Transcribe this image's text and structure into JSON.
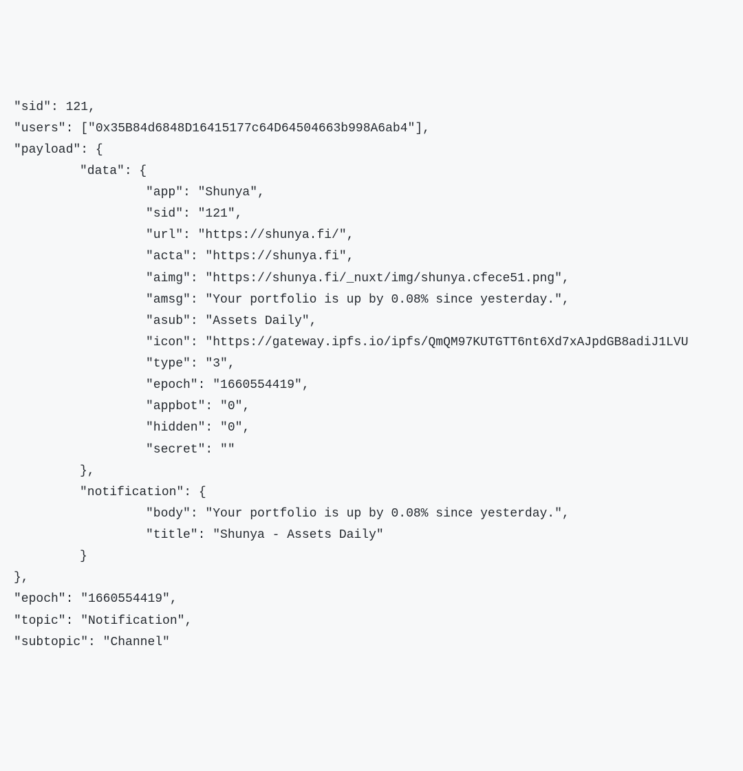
{
  "code": {
    "sid_key": "\"sid\"",
    "sid_val": "121",
    "users_key": "\"users\"",
    "users_val": "[\"0x35B84d6848D16415177c64D64504663b998A6ab4\"]",
    "payload_key": "\"payload\"",
    "data_key": "\"data\"",
    "app_key": "\"app\"",
    "app_val": "\"Shunya\"",
    "data_sid_key": "\"sid\"",
    "data_sid_val": "\"121\"",
    "url_key": "\"url\"",
    "url_val": "\"https://shunya.fi/\"",
    "acta_key": "\"acta\"",
    "acta_val": "\"https://shunya.fi\"",
    "aimg_key": "\"aimg\"",
    "aimg_val": "\"https://shunya.fi/_nuxt/img/shunya.cfece51.png\"",
    "amsg_key": "\"amsg\"",
    "amsg_val": "\"Your portfolio is up by 0.08% since yesterday.\"",
    "asub_key": "\"asub\"",
    "asub_val": "\"Assets Daily\"",
    "icon_key": "\"icon\"",
    "icon_val": "\"https://gateway.ipfs.io/ipfs/QmQM97KUTGTT6nt6Xd7xAJpdGB8adiJ1LVU",
    "type_key": "\"type\"",
    "type_val": "\"3\"",
    "epoch_key": "\"epoch\"",
    "epoch_val": "\"1660554419\"",
    "appbot_key": "\"appbot\"",
    "appbot_val": "\"0\"",
    "hidden_key": "\"hidden\"",
    "hidden_val": "\"0\"",
    "secret_key": "\"secret\"",
    "secret_val": "\"\"",
    "notification_key": "\"notification\"",
    "body_key": "\"body\"",
    "body_val": "\"Your portfolio is up by 0.08% since yesterday.\"",
    "title_key": "\"title\"",
    "title_val": "\"Shunya - Assets Daily\"",
    "outer_epoch_key": "\"epoch\"",
    "outer_epoch_val": "\"1660554419\"",
    "topic_key": "\"topic\"",
    "topic_val": "\"Notification\"",
    "subtopic_key": "\"subtopic\"",
    "subtopic_val": "\"Channel\""
  }
}
